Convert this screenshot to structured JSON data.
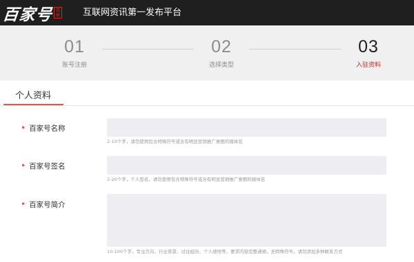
{
  "header": {
    "logo_text": "百家号",
    "logo_seal": "百家",
    "site_title": "互联网资讯第一发布平台"
  },
  "steps": [
    {
      "num": "01",
      "label": "账号注册",
      "active": false
    },
    {
      "num": "02",
      "label": "选择类型",
      "active": false
    },
    {
      "num": "03",
      "label": "入驻资料",
      "active": true
    }
  ],
  "section": {
    "title": "个人资料"
  },
  "fields": {
    "name": {
      "bullet": "•",
      "label": "百家号名称",
      "hint": "2-10个字，请勿使用包含特殊符号或含有明显营销推广意图的媒体名"
    },
    "signature": {
      "bullet": "•",
      "label": "百家号签名",
      "hint": "2-20个字，个人签名，请勿使用包含特殊符号或含有明显营销推广意图的媒体名"
    },
    "intro": {
      "bullet": "•",
      "label": "百家号简介",
      "hint": "10-100个字，专注方向、行业背景、过往经历、个人感悟等，要求内容完整通顺，无特殊符号，请勿添加多种联系方式"
    }
  },
  "colors": {
    "accent": "#d0281f",
    "topbar": "#1f1f1f",
    "input_bg": "#eeeef2"
  }
}
